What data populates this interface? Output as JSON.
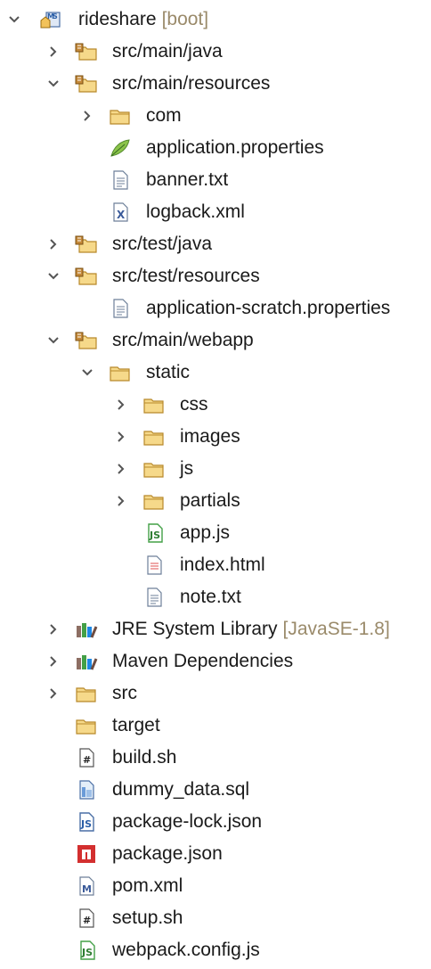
{
  "project": {
    "name": "rideshare",
    "decoration": "[boot]"
  },
  "items": [
    {
      "label": "src/main/java"
    },
    {
      "label": "src/main/resources"
    },
    {
      "label": "com"
    },
    {
      "label": "application.properties"
    },
    {
      "label": "banner.txt"
    },
    {
      "label": "logback.xml"
    },
    {
      "label": "src/test/java"
    },
    {
      "label": "src/test/resources"
    },
    {
      "label": "application-scratch.properties"
    },
    {
      "label": "src/main/webapp"
    },
    {
      "label": "static"
    },
    {
      "label": "css"
    },
    {
      "label": "images"
    },
    {
      "label": "js"
    },
    {
      "label": "partials"
    },
    {
      "label": "app.js"
    },
    {
      "label": "index.html"
    },
    {
      "label": "note.txt"
    },
    {
      "label": "JRE System Library",
      "decoration": "[JavaSE-1.8]"
    },
    {
      "label": "Maven Dependencies"
    },
    {
      "label": "src"
    },
    {
      "label": "target"
    },
    {
      "label": "build.sh"
    },
    {
      "label": "dummy_data.sql"
    },
    {
      "label": "package-lock.json"
    },
    {
      "label": "package.json"
    },
    {
      "label": "pom.xml"
    },
    {
      "label": "setup.sh"
    },
    {
      "label": "webpack.config.js"
    }
  ],
  "icons": {
    "project": "boot-project-icon",
    "source_folder": "source-folder-icon",
    "folder": "folder-icon",
    "properties": "leaf-properties-icon",
    "text": "text-file-icon",
    "xml": "xml-file-icon",
    "js": "javascript-file-icon",
    "html": "html-file-icon",
    "library": "library-icon",
    "shell": "shell-script-icon",
    "sql": "sql-file-icon",
    "json": "json-file-icon",
    "npm": "npm-package-icon",
    "maven": "maven-pom-icon"
  },
  "colors": {
    "folder": "#e9c46a",
    "leaf": "#7cb342",
    "npm": "#d32f2f",
    "js": "#43a047",
    "label": "#1a1a1a",
    "decoration": "#9a8a6a"
  }
}
